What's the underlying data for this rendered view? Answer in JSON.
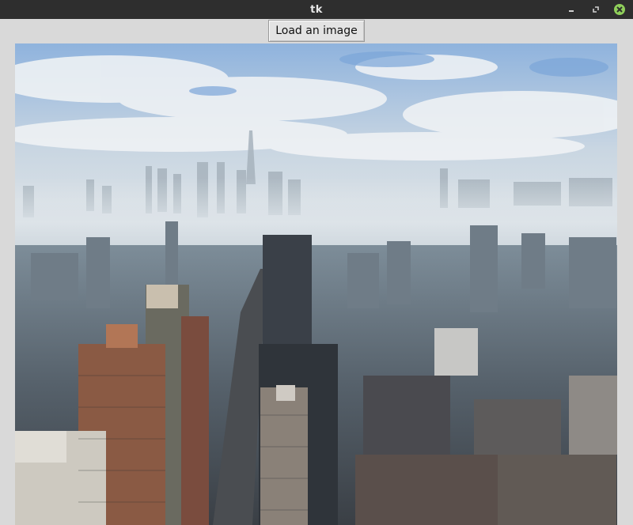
{
  "window": {
    "title": "tk",
    "controls": {
      "minimize_icon": "minimize-icon",
      "maximize_icon": "maximize-icon",
      "close_icon": "close-icon",
      "close_color": "#8fcf5a"
    }
  },
  "toolbar": {
    "load_label": "Load an image"
  },
  "image": {
    "subject": "city-skyline-photo"
  },
  "colors": {
    "titlebar": "#2e2e2e",
    "window_bg": "#d9d9d9",
    "sky": "#6f9ed3",
    "fog": "#d8e0e6"
  }
}
